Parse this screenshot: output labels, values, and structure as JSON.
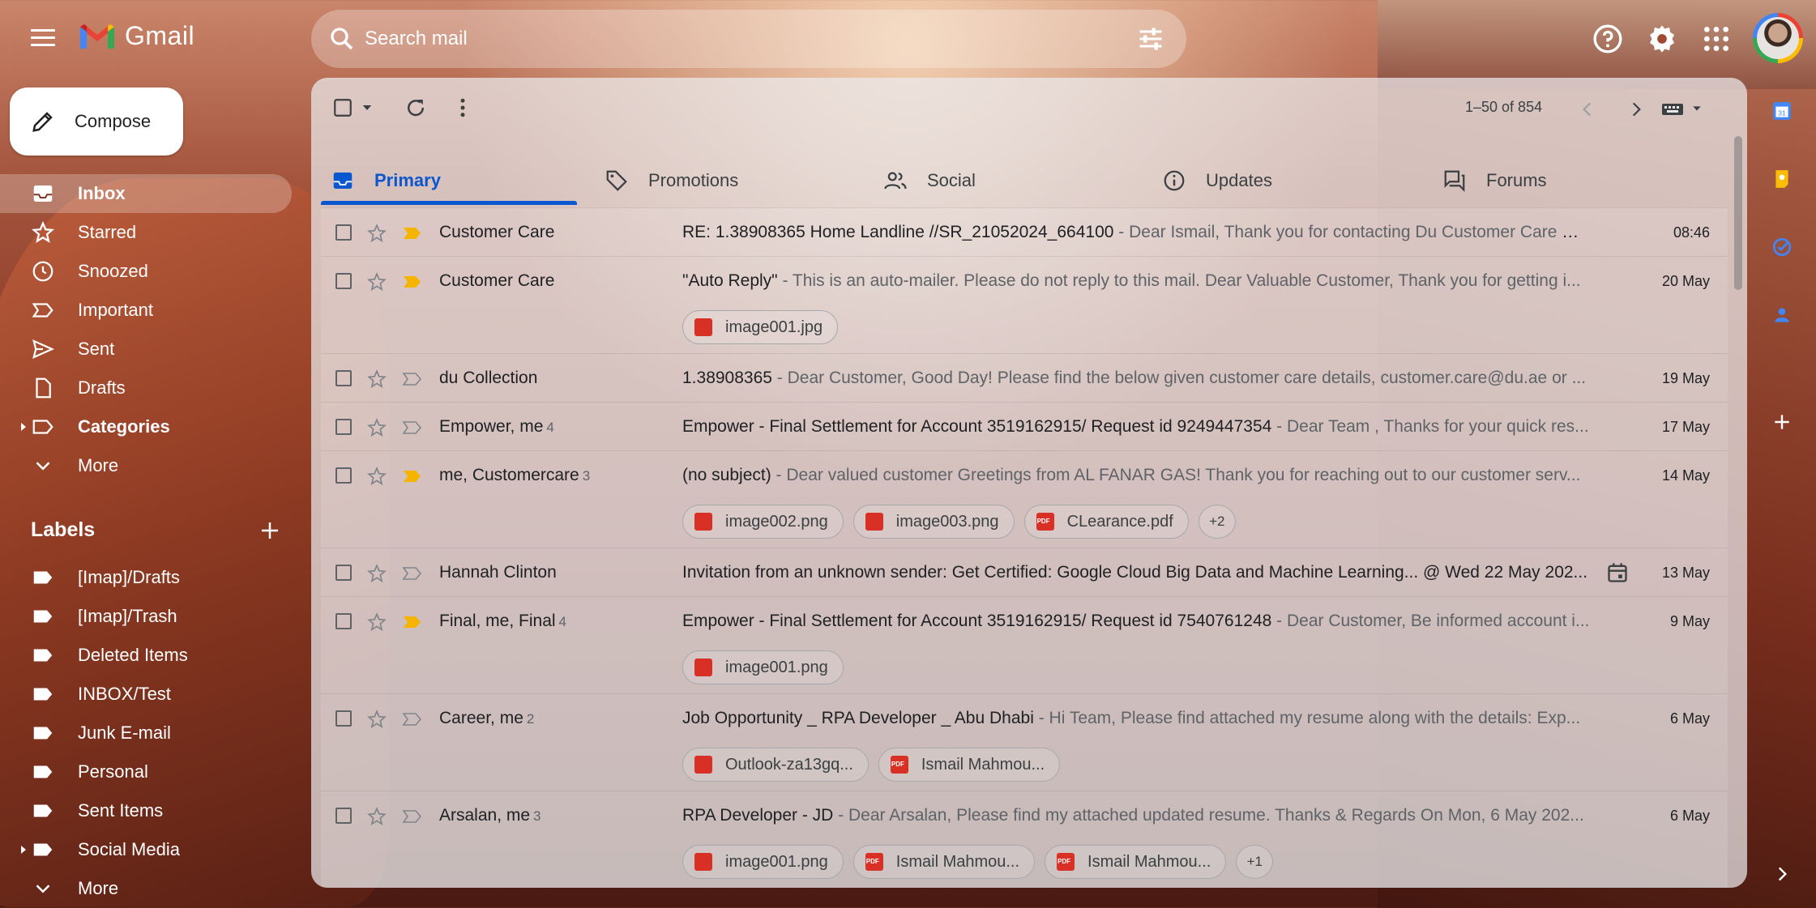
{
  "app": {
    "name": "Gmail"
  },
  "search": {
    "placeholder": "Search mail"
  },
  "compose": {
    "label": "Compose"
  },
  "sidebar": {
    "items": [
      {
        "label": "Inbox",
        "icon": "inbox-icon",
        "active": true
      },
      {
        "label": "Starred",
        "icon": "star-icon"
      },
      {
        "label": "Snoozed",
        "icon": "clock-icon"
      },
      {
        "label": "Important",
        "icon": "important-icon"
      },
      {
        "label": "Sent",
        "icon": "send-icon"
      },
      {
        "label": "Drafts",
        "icon": "draft-icon"
      },
      {
        "label": "Categories",
        "icon": "label-icon"
      },
      {
        "label": "More",
        "icon": "chevron-down-icon"
      }
    ],
    "labels_title": "Labels",
    "labels": [
      "[Imap]/Drafts",
      "[Imap]/Trash",
      "Deleted Items",
      "INBOX/Test",
      "Junk E-mail",
      "Personal",
      "Sent Items",
      "Social Media"
    ],
    "labels_more": "More"
  },
  "toolbar": {
    "pager": "1–50 of 854"
  },
  "tabs": [
    {
      "label": "Primary",
      "icon": "inbox-icon",
      "active": true
    },
    {
      "label": "Promotions",
      "icon": "tag-icon"
    },
    {
      "label": "Social",
      "icon": "people-icon"
    },
    {
      "label": "Updates",
      "icon": "info-icon"
    },
    {
      "label": "Forums",
      "icon": "forum-icon"
    }
  ],
  "emails": [
    {
      "sender": "Customer Care",
      "count": "",
      "subject": "RE: 1.38908365 Home Landline //SR_21052024_664100",
      "snippet": " - Dear Ismail, Thank you for contacting Du Customer Care wit...",
      "date": "08:46",
      "important": true,
      "attachments": []
    },
    {
      "sender": "Customer Care",
      "count": "",
      "subject": "\"Auto Reply\"",
      "snippet": " - This is an auto-mailer. Please do not reply to this mail. Dear Valuable Customer, Thank you for getting i...",
      "date": "20 May",
      "important": true,
      "attachments": [
        {
          "name": "image001.jpg",
          "type": "image"
        }
      ]
    },
    {
      "sender": "du Collection",
      "count": "",
      "subject": "1.38908365",
      "snippet": " - Dear Customer, Good Day! Please find the below given customer care details, customer.care@du.ae or ...",
      "date": "19 May",
      "important": false,
      "attachments": []
    },
    {
      "sender": "Empower, me",
      "count": "4",
      "subject": "Empower - Final Settlement for Account 3519162915/ Request id 9249447354",
      "snippet": " - Dear Team , Thanks for your quick res...",
      "date": "17 May",
      "important": false,
      "attachments": []
    },
    {
      "sender": "me, Customercare",
      "count": "3",
      "subject": "(no subject)",
      "snippet": " - Dear valued customer Greetings from AL FANAR GAS! Thank you for reaching out to our customer serv...",
      "date": "14 May",
      "important": true,
      "attachments": [
        {
          "name": "image002.png",
          "type": "image"
        },
        {
          "name": "image003.png",
          "type": "image"
        },
        {
          "name": "CLearance.pdf",
          "type": "pdf"
        }
      ],
      "more": "+2"
    },
    {
      "sender": "Hannah Clinton",
      "count": "",
      "subject": "Invitation from an unknown sender: Get Certified: Google Cloud Big Data and Machine Learning... @ Wed 22 May 202...",
      "snippet": "",
      "date": "13 May",
      "important": false,
      "attachments": [],
      "calendar": true
    },
    {
      "sender": "Final, me, Final",
      "count": "4",
      "subject": "Empower - Final Settlement for Account 3519162915/ Request id 7540761248",
      "snippet": " - Dear Customer, Be informed account i...",
      "date": "9 May",
      "important": true,
      "attachments": [
        {
          "name": "image001.png",
          "type": "image"
        }
      ]
    },
    {
      "sender": "Career, me",
      "count": "2",
      "subject": "Job Opportunity _ RPA Developer _ Abu Dhabi",
      "snippet": " - Hi Team, Please find attached my resume along with the details: Exp...",
      "date": "6 May",
      "important": false,
      "attachments": [
        {
          "name": "Outlook-za13gq...",
          "type": "image"
        },
        {
          "name": "Ismail Mahmou...",
          "type": "pdf"
        }
      ]
    },
    {
      "sender": "Arsalan, me",
      "count": "3",
      "subject": "RPA Developer - JD",
      "snippet": " - Dear Arsalan, Please find my attached updated resume. Thanks & Regards On Mon, 6 May 202...",
      "date": "6 May",
      "important": false,
      "attachments": [
        {
          "name": "image001.png",
          "type": "image"
        },
        {
          "name": "Ismail Mahmou...",
          "type": "pdf"
        },
        {
          "name": "Ismail Mahmou...",
          "type": "pdf"
        }
      ],
      "more": "+1"
    }
  ],
  "colors": {
    "accent": "#0b57d0",
    "important": "#f4b400",
    "attachment": "#d93025"
  }
}
